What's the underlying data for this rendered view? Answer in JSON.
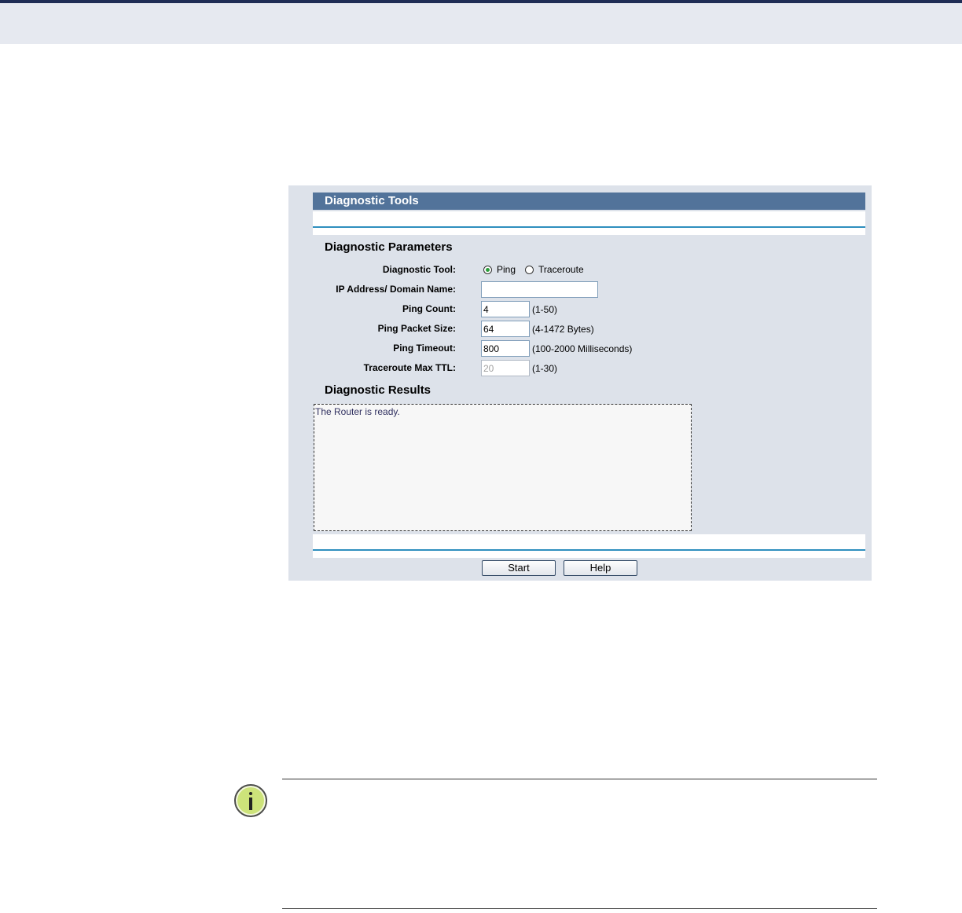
{
  "page": {
    "title": "Diagnostic Tools"
  },
  "parameters": {
    "heading": "Diagnostic Parameters",
    "tool": {
      "label": "Diagnostic Tool:",
      "options": [
        "Ping",
        "Traceroute"
      ],
      "selected": "Ping"
    },
    "ip_address": {
      "label": "IP Address/ Domain Name:",
      "value": ""
    },
    "ping_count": {
      "label": "Ping Count:",
      "value": "4",
      "hint": "(1-50)"
    },
    "ping_packet_size": {
      "label": "Ping Packet Size:",
      "value": "64",
      "hint": "(4-1472 Bytes)"
    },
    "ping_timeout": {
      "label": "Ping Timeout:",
      "value": "800",
      "hint": "(100-2000 Milliseconds)"
    },
    "traceroute_max_ttl": {
      "label": "Traceroute Max TTL:",
      "value": "20",
      "hint": "(1-30)",
      "disabled": true
    }
  },
  "results": {
    "heading": "Diagnostic Results",
    "text": "The Router is ready."
  },
  "buttons": {
    "start_label": "Start",
    "help_label": "Help"
  },
  "note": {
    "icon": "info-icon"
  },
  "colors": {
    "title_bar": "#52739a",
    "panel_bg": "#dde2ea",
    "divider": "#2f8fbe",
    "note_icon": "#cde37a"
  }
}
